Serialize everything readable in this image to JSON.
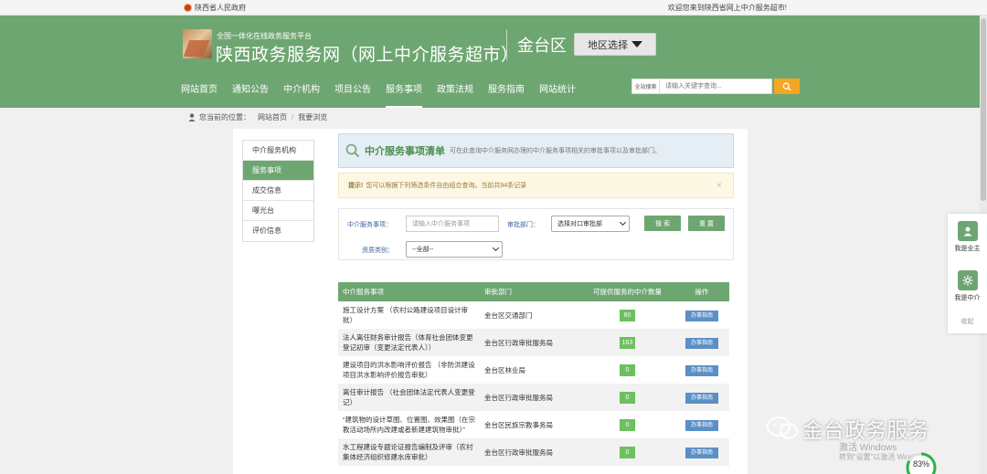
{
  "topbar": {
    "gov_name": "陕西省人民政府",
    "welcome": "欢迎您来到陕西省网上中介服务超市!"
  },
  "header": {
    "subtitle": "全国一体化在线政务服务平台",
    "site_name": "陕西政务服务网（网上中介服务超市）",
    "region": "金台区",
    "region_button": "地区选择"
  },
  "nav": {
    "items": [
      "网站首页",
      "通知公告",
      "中介机构",
      "项目公告",
      "服务事项",
      "政策法规",
      "服务指南",
      "网站统计"
    ],
    "active_index": 4
  },
  "search": {
    "scope": "全站搜索",
    "placeholder": "请输入关键字查询..."
  },
  "breadcrumb": {
    "prefix": "您当前的位置：",
    "home": "网站首页",
    "current": "我要浏览"
  },
  "sidebar": {
    "items": [
      "中介服务机构",
      "服务事项",
      "成交信息",
      "曝光台",
      "评价信息"
    ],
    "active_index": 1
  },
  "panel": {
    "title": "中介服务事项清单",
    "desc": "可在此查询中介服务网办理的中介服务事项相关的审批事项以及审批部门。",
    "tip_strong": "提示!",
    "tip_text": "您可以根据下列筛选条件自由组合查询。当前共94条记录",
    "tip_close": "×"
  },
  "filter": {
    "service_label": "中介服务事项：",
    "service_placeholder": "请输入中介服务事项",
    "dept_label": "审批部门：",
    "dept_selected": "选择对口审批部",
    "type_label": "资质类别：",
    "type_selected": "--全部--",
    "search_button": "搜 索",
    "reset_button": "重 置"
  },
  "table": {
    "headers": [
      "中介服务事项",
      "审批部门",
      "可提供服务的中介数量",
      "操作"
    ],
    "action_label": "办事指南",
    "rows": [
      {
        "item": "施工设计方案 （农村公路建设项目设计审批）",
        "dept": "金台区交通部门",
        "count": "60"
      },
      {
        "item": "法人离任财务审计报告（体育社会团体变更登记初审（变更法定代表人））",
        "dept": "金台区行政审批服务局",
        "count": "163"
      },
      {
        "item": "建设项目的洪水影响评价报告 （非防洪建设项目洪水影响评价报告审批）",
        "dept": "金台区林业局",
        "count": "0"
      },
      {
        "item": "离任审计报告 （社会团体法定代表人变更登记）",
        "dept": "金台区行政审批服务局",
        "count": "0"
      },
      {
        "item": "“建筑物的设计草图、位置图、效果图（在宗教活动场所内改建或者新建建筑物审批）”",
        "dept": "金台区民族宗教事务局",
        "count": "0"
      },
      {
        "item": "水工程建设专题论证报告编制及评审（农村集体经济组织修建水库审批）",
        "dept": "金台区行政审批服务局",
        "count": "0"
      }
    ]
  },
  "floatbar": {
    "owner": "我是业主",
    "agency": "我是中介",
    "collapse": "收起"
  },
  "watermark": {
    "text": "金台政务服务",
    "activate_title": "激活 Windows",
    "activate_sub": "转到“设置”以激活 Windows。",
    "progress": "83%"
  },
  "colors": {
    "brand_green": "#6ea671",
    "badge_green": "#6ebf5e",
    "guide_blue": "#5b8fc7",
    "search_orange": "#f5a623"
  }
}
